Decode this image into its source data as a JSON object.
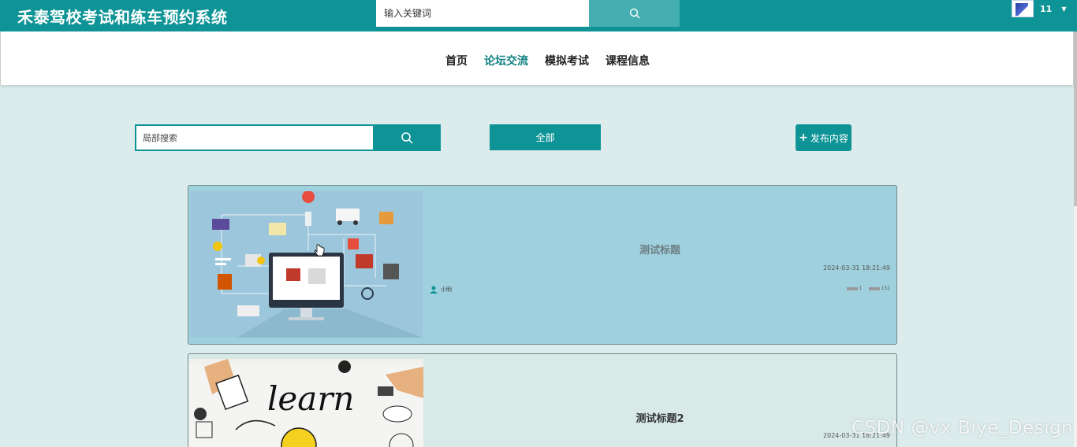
{
  "header": {
    "site_title": "禾泰驾校考试和练车预约系统",
    "search_placeholder": "输入关键词",
    "username": "11"
  },
  "nav": {
    "items": [
      {
        "label": "首页",
        "active": false
      },
      {
        "label": "论坛交流",
        "active": true
      },
      {
        "label": "模拟考试",
        "active": false
      },
      {
        "label": "课程信息",
        "active": false
      }
    ]
  },
  "filters": {
    "search_placeholder": "局部搜索",
    "all_label": "全部",
    "publish_label": "发布内容"
  },
  "posts": [
    {
      "title": "测试标题",
      "time": "2024-03-31 18:21:49",
      "author": "小明",
      "likes": "1",
      "views": "151"
    },
    {
      "title": "测试标题2",
      "time": "2024-03-31 18:21:49"
    }
  ],
  "watermark": "CSDN @vx  Biye_Design",
  "colors": {
    "primary": "#0e9497",
    "card_highlight": "#9fd0dd",
    "background": "#dcebeb"
  }
}
